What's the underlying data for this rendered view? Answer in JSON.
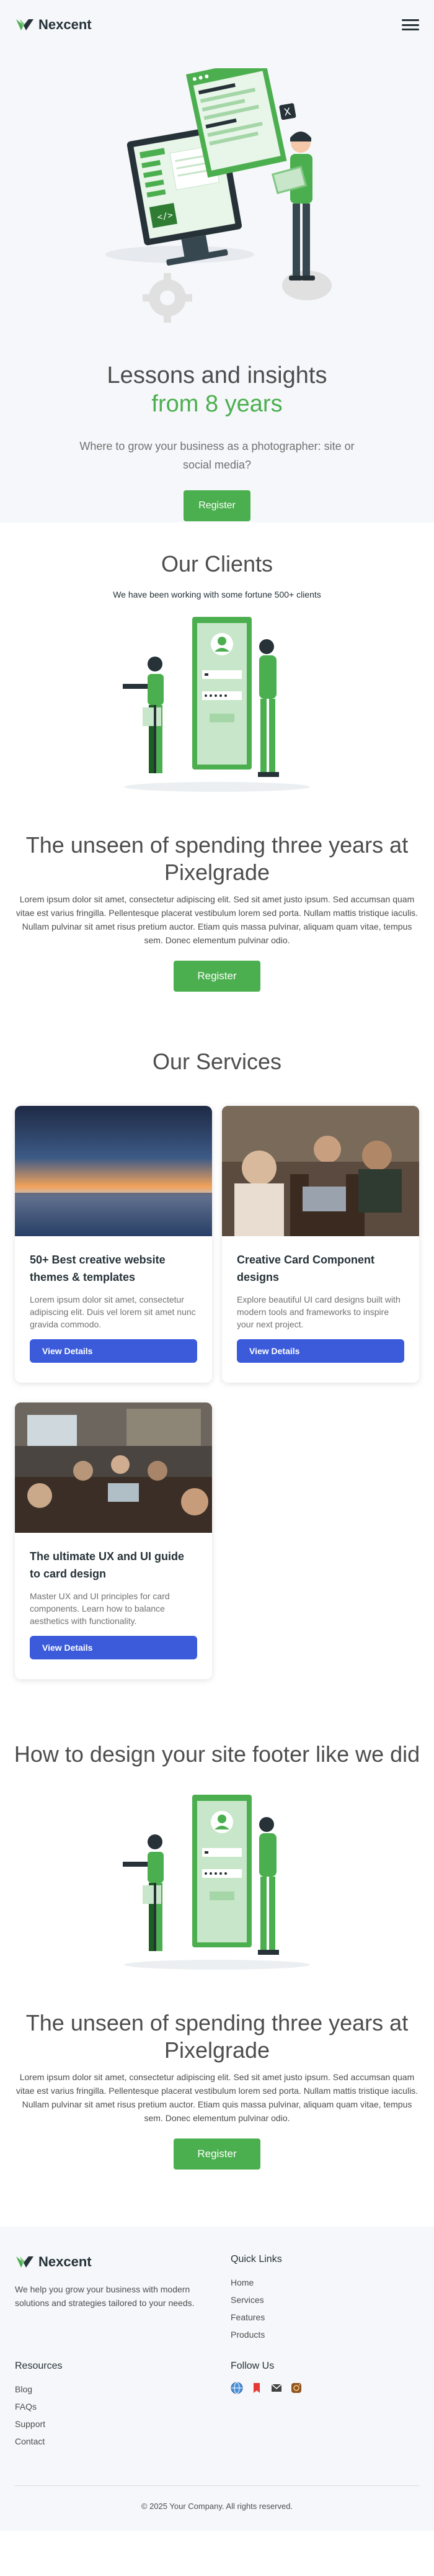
{
  "brand": {
    "name": "Nexcent",
    "accent": "#4caf4f",
    "dark": "#263238"
  },
  "nav": {
    "menu_icon": "hamburger-menu-icon"
  },
  "hero": {
    "title": "Lessons and insights",
    "title_accent": "from 8 years",
    "subtitle": "Where to grow your business as a photographer: site or social media?",
    "cta": "Register"
  },
  "clients": {
    "title": "Our Clients",
    "subtitle": "We have been working with some fortune 500+ clients"
  },
  "unseen": {
    "title": "The unseen of spending three years at Pixelgrade",
    "text": "Lorem ipsum dolor sit amet, consectetur adipiscing elit. Sed sit amet justo ipsum. Sed accumsan quam vitae est varius fringilla. Pellentesque placerat vestibulum lorem sed porta. Nullam mattis tristique iaculis. Nullam pulvinar sit amet risus pretium auctor. Etiam quis massa pulvinar, aliquam quam vitae, tempus sem. Donec elementum pulvinar odio.",
    "cta": "Register"
  },
  "services": {
    "title": "Our Services",
    "cards": [
      {
        "title": "50+ Best creative website themes & templates",
        "desc": "Lorem ipsum dolor sit amet, consectetur adipiscing elit. Duis vel lorem sit amet nunc gravida commodo.",
        "cta": "View Details"
      },
      {
        "title": "Creative Card Component designs",
        "desc": "Explore beautiful UI card designs built with modern tools and frameworks to inspire your next project.",
        "cta": "View Details"
      },
      {
        "title": "The ultimate UX and UI guide to card design",
        "desc": "Master UX and UI principles for card components. Learn how to balance aesthetics with functionality.",
        "cta": "View Details"
      }
    ]
  },
  "footer_design": {
    "title": "How to design your site footer like we did",
    "unseen_title": "The unseen of spending three years at Pixelgrade",
    "unseen_text": "Lorem ipsum dolor sit amet, consectetur adipiscing elit. Sed sit amet justo ipsum. Sed accumsan quam vitae est varius fringilla. Pellentesque placerat vestibulum lorem sed porta. Nullam mattis tristique iaculis. Nullam pulvinar sit amet risus pretium auctor. Etiam quis massa pulvinar, aliquam quam vitae, tempus sem. Donec elementum pulvinar odio.",
    "cta": "Register"
  },
  "footer": {
    "brand": "Nexcent",
    "description": "We help you grow your business with modern solutions and strategies tailored to your needs.",
    "quick_links": {
      "heading": "Quick Links",
      "items": [
        "Home",
        "Services",
        "Features",
        "Products"
      ]
    },
    "resources": {
      "heading": "Resources",
      "items": [
        "Blog",
        "FAQs",
        "Support",
        "Contact"
      ]
    },
    "follow": {
      "heading": "Follow Us",
      "icons": [
        "globe-icon",
        "bookmark-icon",
        "mail-icon",
        "instagram-icon"
      ]
    },
    "copyright": "© 2025 Your Company. All rights reserved."
  }
}
